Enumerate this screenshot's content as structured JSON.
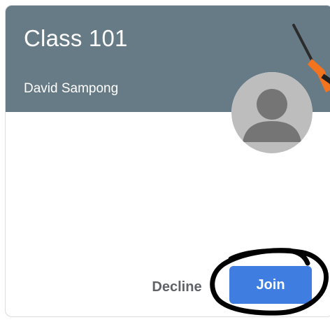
{
  "card": {
    "title": "Class 101",
    "teacher": "David Sampong"
  },
  "avatar": {
    "icon": "person-avatar-icon"
  },
  "banner_art": {
    "icon": "tools-illustration-icon"
  },
  "actions": {
    "decline_label": "Decline",
    "join_label": "Join"
  },
  "annotation": {
    "type": "hand-drawn circle around Join button"
  },
  "colors": {
    "banner": "#677b87",
    "join_button": "#3f7de0",
    "decline_text": "#5f6368",
    "avatar_bg": "#bdbdbd",
    "avatar_figure": "#757575",
    "tool_orange": "#f4731f"
  }
}
